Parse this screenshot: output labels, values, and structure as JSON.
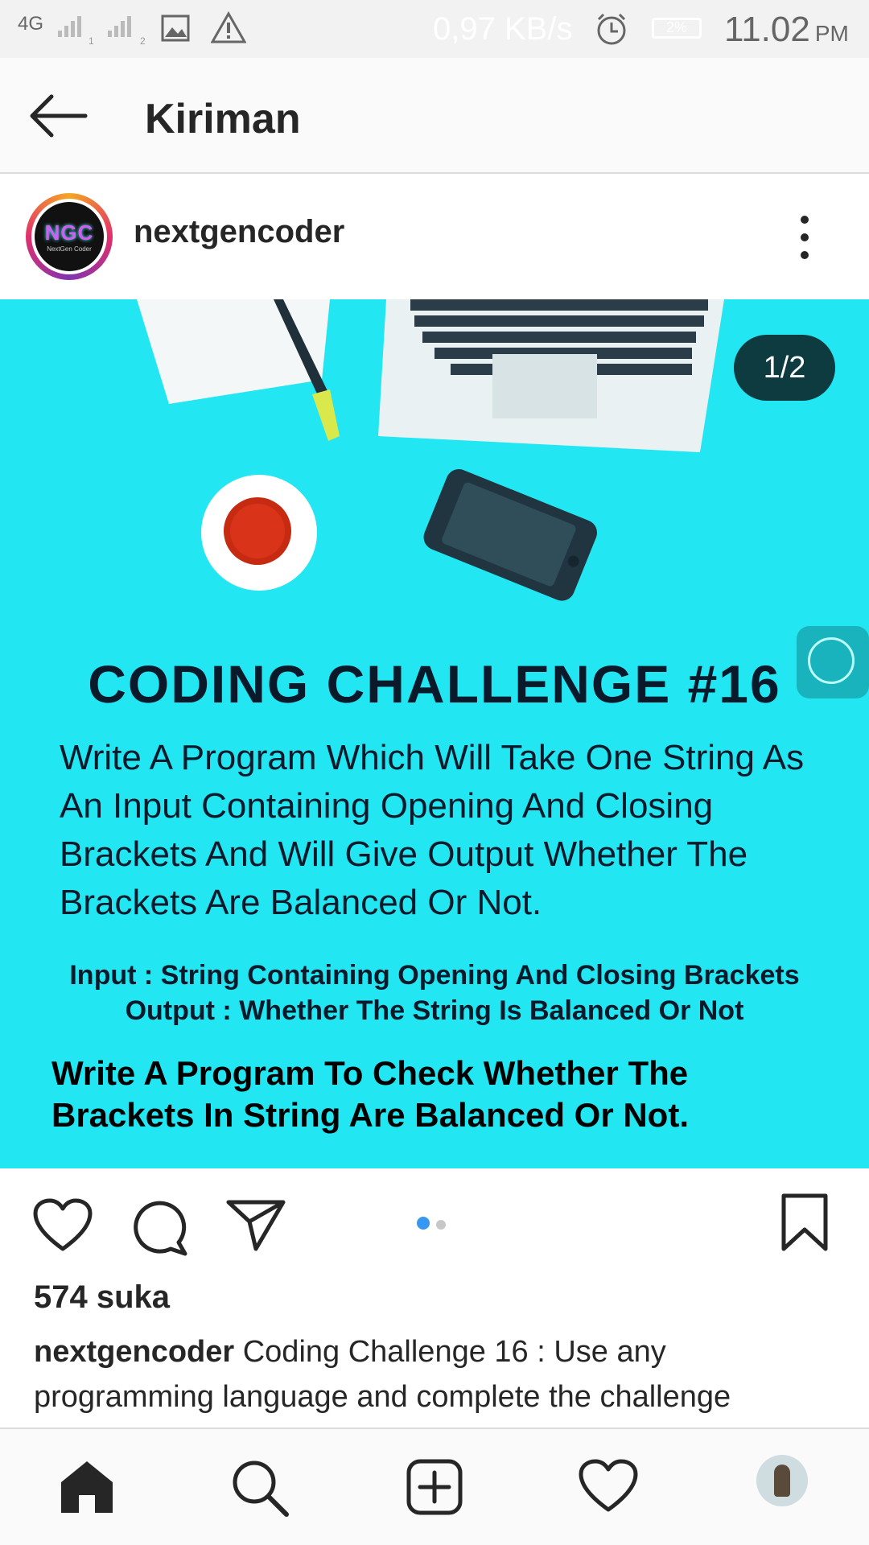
{
  "status_bar": {
    "network": "4G",
    "sim1": "1",
    "sim2": "2",
    "speed": "0,97 KB/s",
    "battery": "2%",
    "time": "11.02",
    "ampm": "PM"
  },
  "header": {
    "title": "Kiriman"
  },
  "post": {
    "username": "nextgencoder",
    "avatar_text": "NGC",
    "avatar_subtext": "NextGen Coder",
    "counter": "1/2",
    "image": {
      "heading": "CODING CHALLENGE  #16",
      "body": "Write A Program Which Will Take One String As An Input Containing Opening And Closing Brackets  And Will Give Output Whether The Brackets Are Balanced Or Not.",
      "input_line": "Input : String Containing Opening And Closing Brackets",
      "output_line": "Output : Whether The String Is Balanced Or Not",
      "task": "Write A Program To Check Whether The Brackets In String Are Balanced Or Not."
    },
    "likes": "574 suka",
    "caption_user": "nextgencoder",
    "caption_text": "Coding Challenge 16 : Use any programming language and complete the challenge",
    "carousel": {
      "current": 1,
      "total": 2
    }
  },
  "colors": {
    "image_bg": "#22e6f2",
    "dot_active": "#3897f0",
    "dot_inactive": "#c7c7c7"
  },
  "icons": [
    "back-arrow-icon",
    "more-options-icon",
    "heart-icon",
    "comment-icon",
    "share-icon",
    "bookmark-icon",
    "home-icon",
    "search-icon",
    "add-post-icon",
    "activity-heart-icon"
  ]
}
